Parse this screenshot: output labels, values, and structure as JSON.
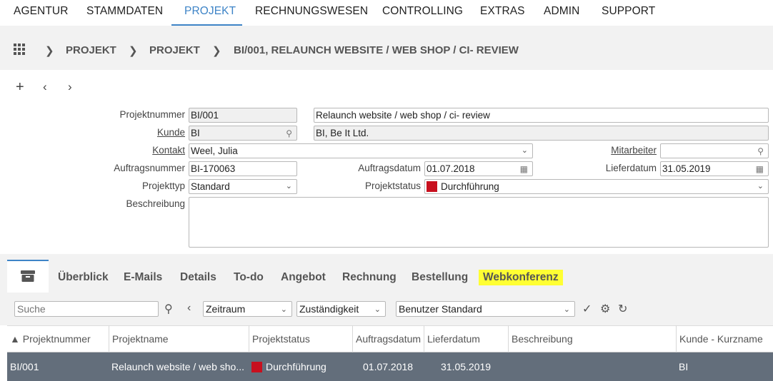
{
  "nav": {
    "items": [
      "AGENTUR",
      "STAMMDATEN",
      "PROJEKT",
      "RECHNUNGSWESEN",
      "CONTROLLING",
      "EXTRAS",
      "ADMIN",
      "SUPPORT"
    ],
    "active": "PROJEKT"
  },
  "breadcrumb": [
    "PROJEKT",
    "PROJEKT",
    "BI/001, RELAUNCH WEBSITE / WEB SHOP / CI- REVIEW"
  ],
  "form": {
    "projektnummer_label": "Projektnummer",
    "projektnummer": "BI/001",
    "projektname": "Relaunch website / web shop / ci- review",
    "kunde_label": "Kunde",
    "kunde": "BI",
    "kunde_name": "BI, Be It Ltd.",
    "kontakt_label": "Kontakt",
    "kontakt": "Weel, Julia",
    "mitarbeiter_label": "Mitarbeiter",
    "mitarbeiter": "",
    "auftragsnummer_label": "Auftragsnummer",
    "auftragsnummer": "BI-170063",
    "auftragsdatum_label": "Auftragsdatum",
    "auftragsdatum": "01.07.2018",
    "lieferdatum_label": "Lieferdatum",
    "lieferdatum": "31.05.2019",
    "projekttyp_label": "Projekttyp",
    "projekttyp": "Standard",
    "projektstatus_label": "Projektstatus",
    "projektstatus": "Durchführung",
    "beschreibung_label": "Beschreibung",
    "beschreibung": ""
  },
  "tabs": [
    "Überblick",
    "E-Mails",
    "Details",
    "To-do",
    "Angebot",
    "Rechnung",
    "Bestellung",
    "Webkonferenz"
  ],
  "filters": {
    "search_placeholder": "Suche",
    "zeitraum": "Zeitraum",
    "zustaendigkeit": "Zuständigkeit",
    "ansicht": "Benutzer Standard"
  },
  "table": {
    "headers": [
      "▲ Projektnummer",
      "Projektname",
      "Projektstatus",
      "Auftragsdatum",
      "Lieferdatum",
      "Beschreibung",
      "Kunde - Kurzname"
    ],
    "rows": [
      {
        "projektnummer": "BI/001",
        "projektname": "Relaunch website / web sho...",
        "projektstatus": "Durchführung",
        "auftragsdatum": "01.07.2018",
        "lieferdatum": "31.05.2019",
        "beschreibung": "",
        "kunde": "BI"
      }
    ]
  },
  "colors": {
    "accent": "#3e84c7",
    "status_red": "#c8101e",
    "row_selected": "#636e7b",
    "highlight": "#ffff33"
  }
}
